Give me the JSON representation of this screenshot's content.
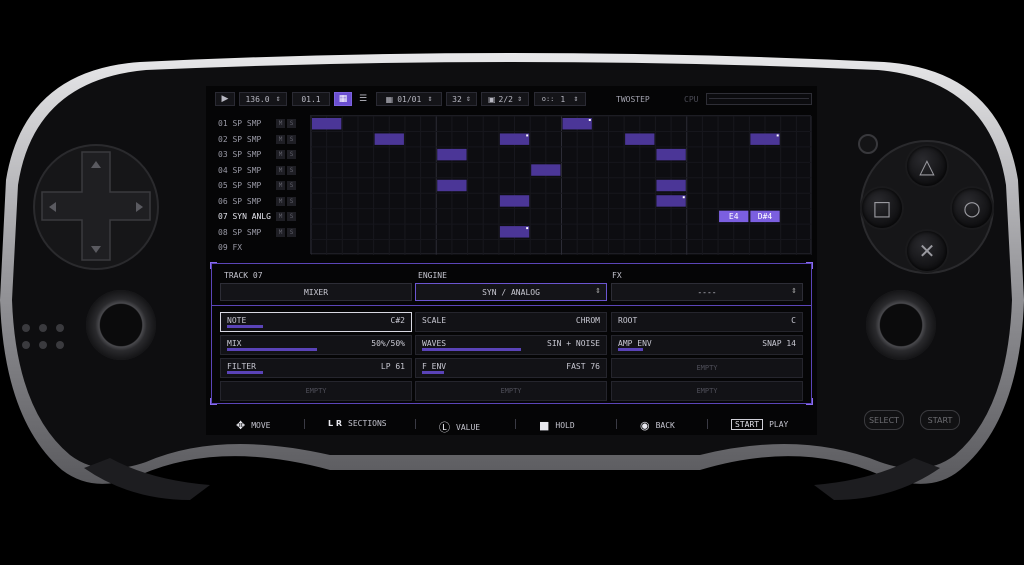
{
  "app": {
    "name": "TWOSTEP",
    "cpu_label": "CPU"
  },
  "colors": {
    "accent": "#6b4fd0",
    "note": "#4b3697",
    "note_label": "#7b5fe0",
    "frame": "#5b45b8"
  },
  "topbar": {
    "play_icon": "play-icon",
    "tempo": "136.0",
    "position": "01.1",
    "pattern": "01/01",
    "steps": "32",
    "page": "2/2",
    "swing": "1"
  },
  "tracks": [
    {
      "name": "01 SP SMP",
      "m": "M",
      "s": "S"
    },
    {
      "name": "02 SP SMP",
      "m": "M",
      "s": "S"
    },
    {
      "name": "03 SP SMP",
      "m": "M",
      "s": "S"
    },
    {
      "name": "04 SP SMP",
      "m": "M",
      "s": "S"
    },
    {
      "name": "05 SP SMP",
      "m": "M",
      "s": "S"
    },
    {
      "name": "06 SP SMP",
      "m": "M",
      "s": "S"
    },
    {
      "name": "07 SYN ANLG",
      "m": "M",
      "s": "S"
    },
    {
      "name": "08 SP SMP",
      "m": "M",
      "s": "S"
    },
    {
      "name": "09 FX"
    }
  ],
  "sequencer": {
    "steps_visible": 32,
    "notes": [
      {
        "track": 0,
        "step": 0,
        "len": 2
      },
      {
        "track": 0,
        "step": 16,
        "len": 2,
        "marker": true
      },
      {
        "track": 1,
        "step": 4,
        "len": 2
      },
      {
        "track": 1,
        "step": 12,
        "len": 2,
        "marker": true
      },
      {
        "track": 1,
        "step": 20,
        "len": 2
      },
      {
        "track": 1,
        "step": 28,
        "len": 2,
        "marker": true
      },
      {
        "track": 2,
        "step": 8,
        "len": 2
      },
      {
        "track": 2,
        "step": 22,
        "len": 2
      },
      {
        "track": 3,
        "step": 14,
        "len": 2
      },
      {
        "track": 4,
        "step": 8,
        "len": 2
      },
      {
        "track": 4,
        "step": 22,
        "len": 2
      },
      {
        "track": 5,
        "step": 12,
        "len": 2
      },
      {
        "track": 5,
        "step": 22,
        "len": 2,
        "marker": true
      },
      {
        "track": 6,
        "step": 26,
        "len": 2,
        "label": "E4"
      },
      {
        "track": 6,
        "step": 28,
        "len": 2,
        "label": "D#4"
      },
      {
        "track": 7,
        "step": 12,
        "len": 2,
        "marker": true
      }
    ]
  },
  "track_panel": {
    "track_label": "TRACK 07",
    "engine_label": "ENGINE",
    "fx_label": "FX",
    "mixer_button": "MIXER",
    "engine_value": "SYN / ANALOG",
    "fx_value": "----"
  },
  "params": [
    {
      "label": "NOTE",
      "value": "C#2",
      "level": 0.2,
      "selected": true
    },
    {
      "label": "SCALE",
      "value": "CHROM",
      "level": null
    },
    {
      "label": "ROOT",
      "value": "C",
      "level": null
    },
    {
      "label": "MIX",
      "value": "50%/50%",
      "level": 0.5
    },
    {
      "label": "WAVES",
      "value": "SIN + NOISE",
      "level": 0.55
    },
    {
      "label": "AMP ENV",
      "value": "SNAP 14",
      "level": 0.14
    },
    {
      "label": "FILTER",
      "value": "LP 61",
      "level": 0.2
    },
    {
      "label": "F ENV",
      "value": "FAST 76",
      "level": 0.12
    },
    {
      "label": "",
      "value": "",
      "empty": "EMPTY"
    },
    {
      "label": "",
      "value": "",
      "empty": "EMPTY"
    },
    {
      "label": "",
      "value": "",
      "empty": "EMPTY"
    },
    {
      "label": "",
      "value": "",
      "empty": "EMPTY"
    }
  ],
  "hints": [
    {
      "icon": "dpad-icon",
      "glyph": "✥",
      "text": "MOVE"
    },
    {
      "icon": "lr-icon",
      "glyph": "L R",
      "text": "SECTIONS"
    },
    {
      "icon": "left-stick-icon",
      "glyph": "Ⓛ",
      "text": "VALUE"
    },
    {
      "icon": "square-icon",
      "glyph": "■",
      "text": "HOLD"
    },
    {
      "icon": "circle-icon",
      "glyph": "◉",
      "text": "BACK"
    },
    {
      "icon": "start-icon",
      "glyph": "START",
      "text": "PLAY"
    }
  ],
  "device": {
    "select_label": "SELECT",
    "start_label": "START"
  }
}
